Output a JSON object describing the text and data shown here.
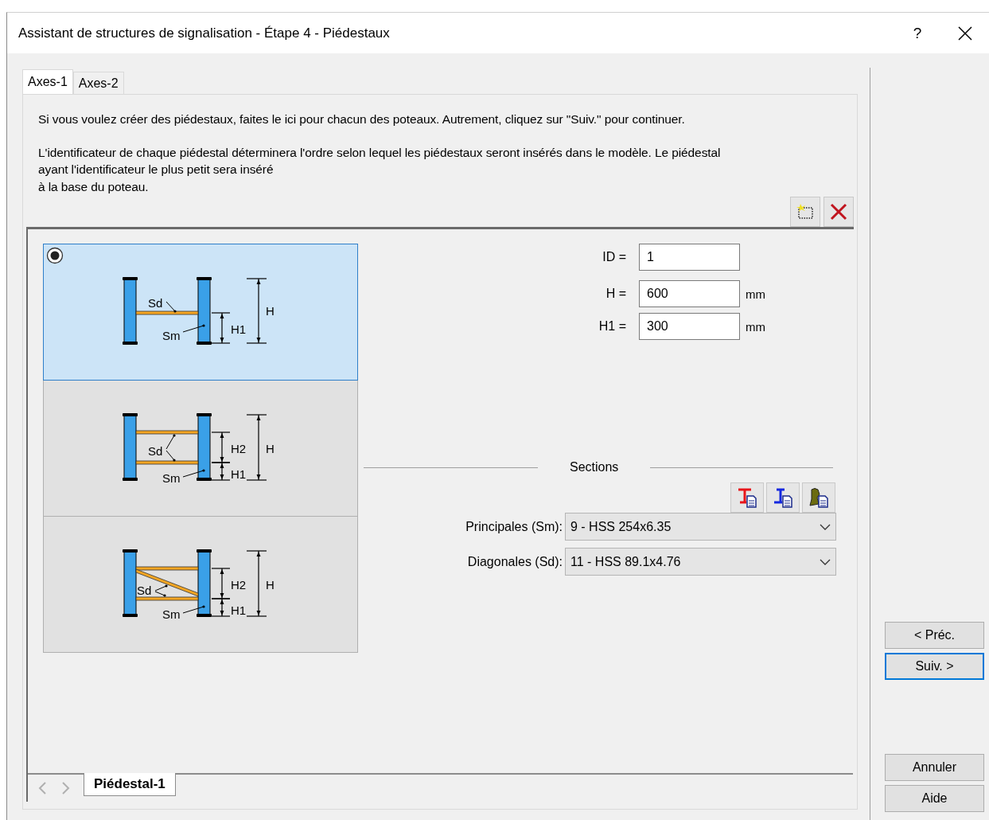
{
  "window": {
    "title": "Assistant de structures de signalisation - Étape 4 - Piédestaux",
    "help": "?"
  },
  "tabs": [
    {
      "label": "Axes-1",
      "selected": true
    },
    {
      "label": "Axes-2",
      "selected": false
    }
  ],
  "description": [
    "Si vous voulez créer des piédestaux, faites le ici pour chacun des poteaux. Autrement, cliquez sur \"Suiv.\" pour continuer.",
    "L'identificateur de chaque piédestal déterminera l'ordre selon lequel les piédestaux seront insérés dans le modèle. Le piédestal\nayant l'identificateur le plus petit sera inséré\nà la base du poteau."
  ],
  "options": [
    {
      "kind": "single",
      "selected": true,
      "labels": {
        "sd": "Sd",
        "sm": "Sm",
        "h1": "H1",
        "h": "H"
      }
    },
    {
      "kind": "double",
      "selected": false,
      "labels": {
        "sd": "Sd",
        "sm": "Sm",
        "h1": "H1",
        "h2": "H2",
        "h": "H"
      }
    },
    {
      "kind": "diagonal",
      "selected": false,
      "labels": {
        "sd": "Sd",
        "sm": "Sm",
        "h1": "H1",
        "h2": "H2",
        "h": "H"
      }
    }
  ],
  "fields": [
    {
      "label": "ID =",
      "value": "1"
    },
    {
      "label": "H =",
      "value": "600",
      "unit": "mm"
    },
    {
      "label": "H1 =",
      "value": "300",
      "unit": "mm"
    }
  ],
  "sections": {
    "title": "Sections",
    "combos": [
      {
        "label": "Principales (Sm):",
        "value": "9 - HSS 254x6.35"
      },
      {
        "label": "Diagonales (Sd):",
        "value": "11 - HSS 89.1x4.76"
      }
    ]
  },
  "bottom_tabs": [
    {
      "label": "Piédestal-1",
      "selected": true
    }
  ],
  "nav_buttons": [
    {
      "label": "< Préc.",
      "focused": false
    },
    {
      "label": "Suiv. >",
      "focused": true
    }
  ],
  "action_buttons": [
    {
      "label": "Annuler"
    },
    {
      "label": "Aide"
    }
  ]
}
